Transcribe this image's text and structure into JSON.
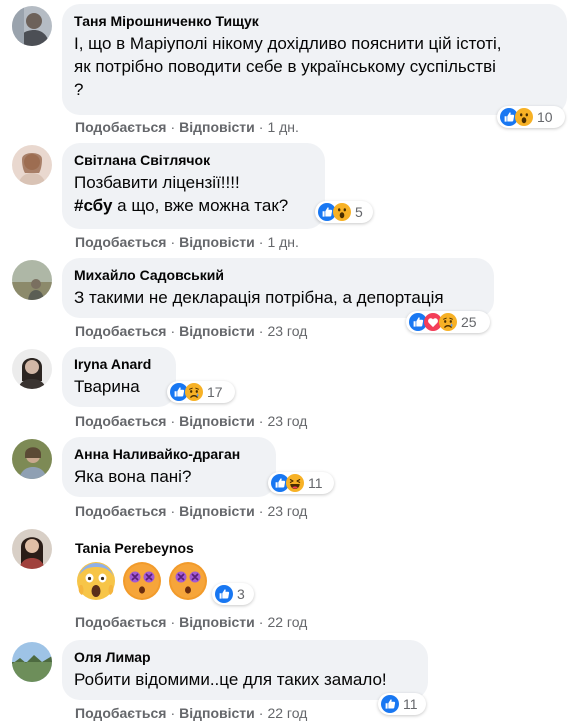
{
  "comments": [
    {
      "author": "Таня Мірошниченко Тищук",
      "lines": [
        "І, що в Маріуполі нікому дохідливо пояснити цій істоті,",
        "як потрібно поводити себе в українському суспільстві",
        "?"
      ],
      "reaction_icons": [
        "like-icon",
        "wow-icon"
      ],
      "reaction_count": "10",
      "like_label": "Подобається",
      "reply_label": "Відповісти",
      "time": "1 дн."
    },
    {
      "author": "Світлана Світлячок",
      "line1": "Позбавити ліцензії!!!!",
      "hashtag": "#сбу",
      "line2_rest": " а що, вже можна так?",
      "reaction_icons": [
        "like-icon",
        "wow-icon"
      ],
      "reaction_count": "5",
      "like_label": "Подобається",
      "reply_label": "Відповісти",
      "time": "1 дн."
    },
    {
      "author": "Михайло Садовський",
      "lines": [
        "З такими не декларація потрібна, а депортація"
      ],
      "reaction_icons": [
        "like-icon",
        "love-icon",
        "sad-icon"
      ],
      "reaction_count": "25",
      "like_label": "Подобається",
      "reply_label": "Відповісти",
      "time": "23 год"
    },
    {
      "author": "Iryna Anard",
      "lines": [
        "Тварина"
      ],
      "reaction_icons": [
        "like-icon",
        "sad-icon"
      ],
      "reaction_count": "17",
      "like_label": "Подобається",
      "reply_label": "Відповісти",
      "time": "23 год"
    },
    {
      "author": "Анна Наливайко-драган",
      "lines": [
        "Яка вона пані?"
      ],
      "reaction_icons": [
        "like-icon",
        "haha-icon"
      ],
      "reaction_count": "11",
      "like_label": "Подобається",
      "reply_label": "Відповісти",
      "time": "23 год"
    },
    {
      "author": "Tania Perebeynos",
      "emojis": [
        "screaming-face-emoji",
        "dizzy-face-emoji",
        "dizzy-face-emoji"
      ],
      "reaction_icons": [
        "like-icon"
      ],
      "reaction_count": "3",
      "like_label": "Подобається",
      "reply_label": "Відповісти",
      "time": "22 год"
    },
    {
      "author": "Оля Лимар",
      "lines": [
        "Робити відомими..це для таких замало!"
      ],
      "reaction_icons": [
        "like-icon"
      ],
      "reaction_count": "11",
      "like_label": "Подобається",
      "reply_label": "Відповісти",
      "time": "22 год"
    }
  ],
  "separator": "·",
  "colors": {
    "bubble": "#f0f2f5",
    "meta_text": "#65676b",
    "like_blue": "#1877f2",
    "love_red": "#f33e58",
    "emoji_yellow": "#f7b125",
    "emoji_purple": "#a35ad3"
  }
}
